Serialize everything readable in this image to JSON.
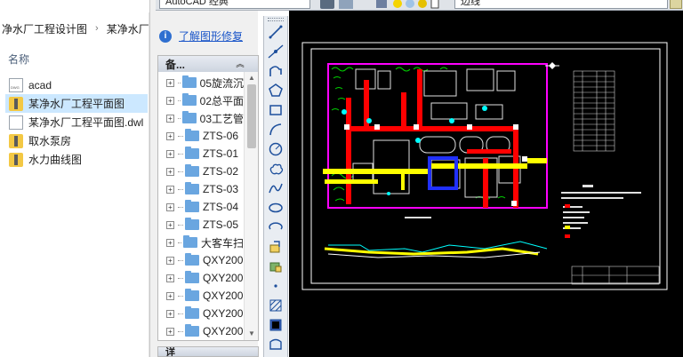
{
  "explorer": {
    "breadcrumb": [
      "净水厂工程设计图",
      "某净水厂工"
    ],
    "column_header": "名称",
    "files": [
      {
        "name": "acad",
        "icon": "cad-file-icon",
        "selected": false
      },
      {
        "name": "某净水厂工程平面图",
        "icon": "zip-folder-icon",
        "selected": true
      },
      {
        "name": "某净水厂工程平面图.dwl",
        "icon": "document-icon",
        "selected": false
      },
      {
        "name": "取水泵房",
        "icon": "zip-folder-icon",
        "selected": false
      },
      {
        "name": "水力曲线图",
        "icon": "zip-folder-icon",
        "selected": false
      }
    ]
  },
  "design_center": {
    "info_link": "了解图形修复",
    "tree_header": "备...",
    "tree_items": [
      "05旋流沉",
      "02总平面",
      "03工艺管",
      "ZTS-06",
      "ZTS-01",
      "ZTS-02",
      "ZTS-03",
      "ZTS-04",
      "ZTS-05",
      "大客车扫",
      "QXY200",
      "QXY200",
      "QXY200",
      "QXY200",
      "QXY200"
    ],
    "bottom_section": "详"
  },
  "acad_toolbar": {
    "workspace": "AutoCAD 经典",
    "layer_name": "边线"
  },
  "draw_tools": [
    "line-icon",
    "construction-line-icon",
    "polyline-icon",
    "polygon-icon",
    "rectangle-icon",
    "arc-icon",
    "circle-icon",
    "revision-cloud-icon",
    "spline-icon",
    "ellipse-icon",
    "ellipse-arc-icon",
    "insert-block-icon",
    "make-block-icon",
    "point-icon",
    "hatch-icon",
    "gradient-icon",
    "region-icon"
  ],
  "colors": {
    "canvas_bg": "#000000",
    "selection_bg": "#cce8ff",
    "link": "#1a55c8",
    "pipe_red": "#ff0000",
    "pipe_yellow": "#ffff00",
    "boundary_magenta": "#ff00ff"
  }
}
